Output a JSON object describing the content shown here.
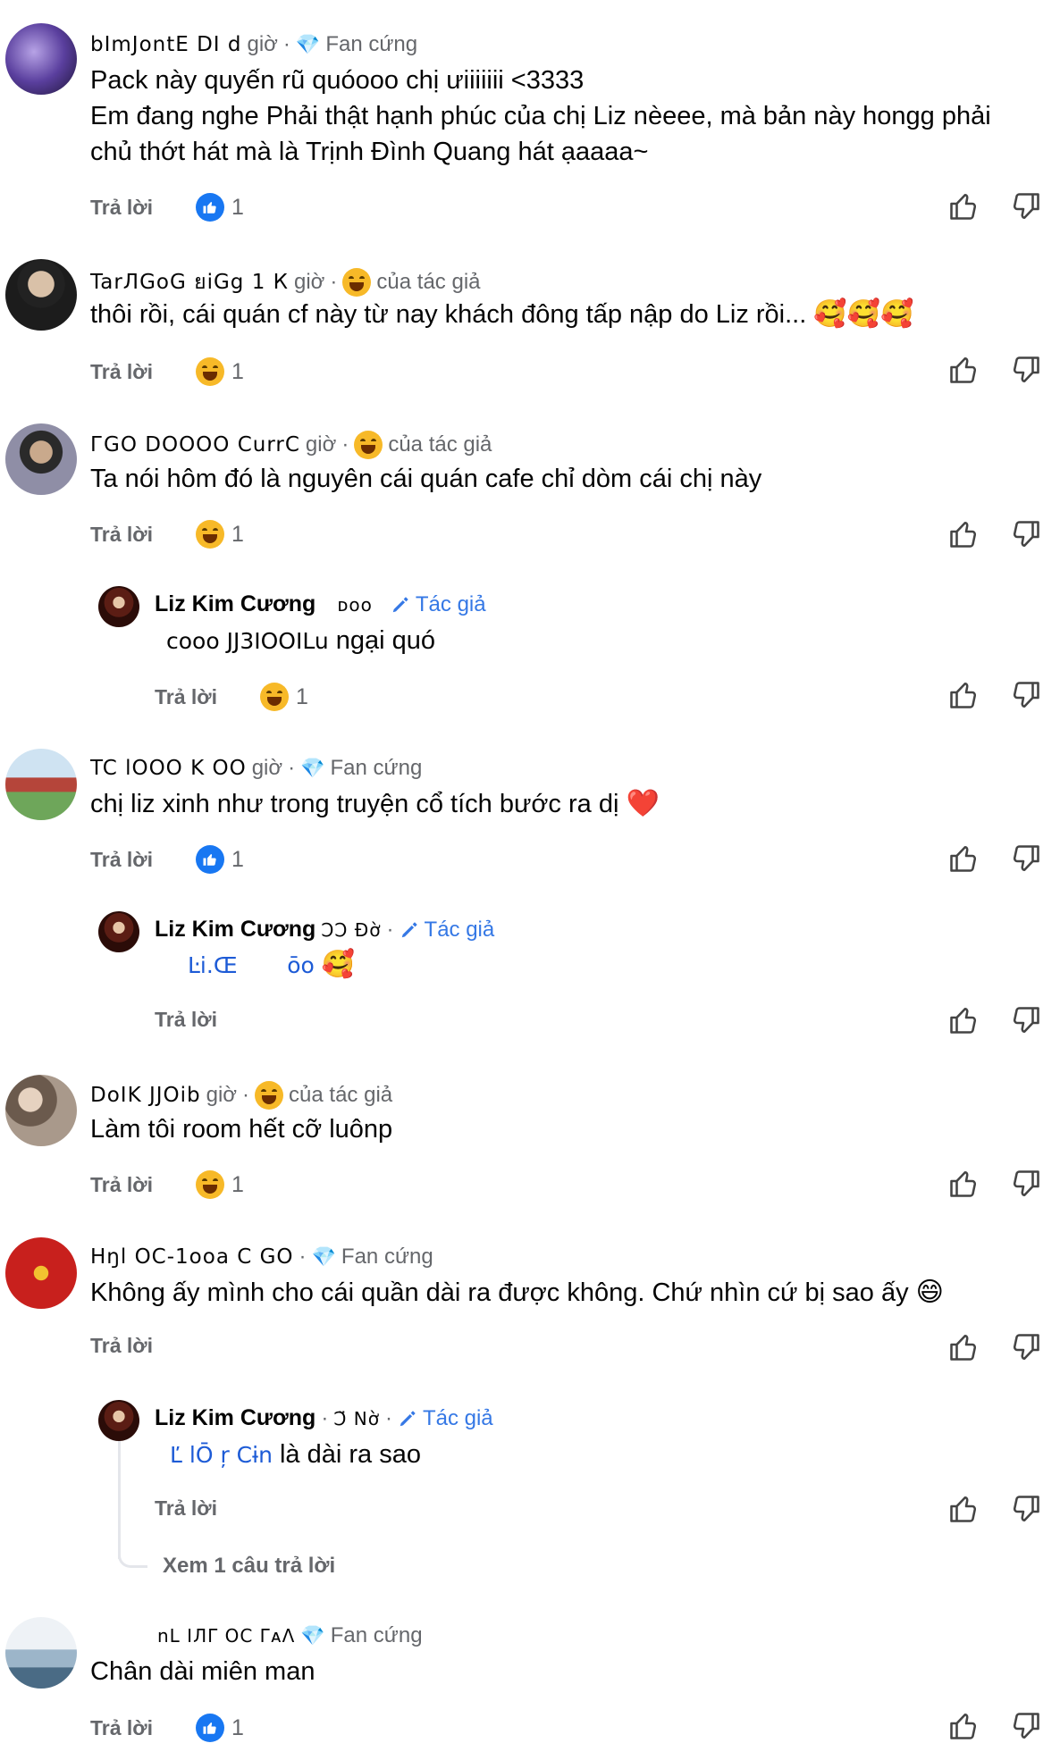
{
  "labels": {
    "reply": "Trả lời",
    "fan": "Fan cứng",
    "author_reacted": "của tác giả",
    "author_tag": "Tác giả",
    "hours_suffix": "giờ",
    "see_replies": "Xem 1 câu trả lời"
  },
  "colors": {
    "blue": "#1877f2",
    "gray": "#65676b",
    "author": "#3578e5"
  },
  "comments": [
    {
      "name": "bImJontE DI d",
      "time": "giờ",
      "badge": "Fan cứng",
      "text1": "Pack này quyến rũ quóooo chị ưiiiiiii <3333",
      "text2": "Em đang nghe Phải thật hạnh phúc của chị Liz nèeee, mà bản này hongg phải",
      "text3": "chủ thớt hát mà là Trịnh Đình Quang hát ạaaaa~",
      "reaction": "like",
      "count": "1"
    },
    {
      "name": "TarЛGoG ยiGg 1 К",
      "time": "giờ",
      "badge": "của tác giả",
      "text1": "thôi rồi, cái quán cf này từ nay khách đông tấp nập do Liz rồi...",
      "emoji": "🥰🥰🥰",
      "reaction": "haha",
      "count": "1"
    },
    {
      "name": "ГGO DOOOO CurrC",
      "time": "giờ",
      "badge": "của tác giả",
      "text1": "Ta nói hôm đó là nguyên cái quán cafe chỉ dòm cái chị này",
      "reaction": "haha",
      "count": "1",
      "reply": {
        "name": "Liz Kim Cương",
        "time": "ᴅᴏᴏ",
        "tag": "Tác giả",
        "link": "cooo JJ3IOOILu",
        "text": "ngại quó",
        "reaction": "haha",
        "count": "1"
      }
    },
    {
      "name": "TC lOOO K OO",
      "time": "giờ",
      "badge": "Fan cứng",
      "text1": "chị liz xinh như trong truyện cổ tích bước ra dị",
      "emoji": "❤️",
      "reaction": "like",
      "count": "1",
      "reply": {
        "name": "Liz Kim Cương",
        "time": "ϽϽ Đờ",
        "tag": "Tác giả",
        "link": "Ŀi.Œ       ōo",
        "text": "",
        "emoji": "🥰"
      }
    },
    {
      "name": "DoIK JJOib",
      "time": "giờ",
      "badge": "của tác giả",
      "text1": "Làm tôi room hết cỡ luônp",
      "reaction": "haha",
      "count": "1"
    },
    {
      "name": "Hŋl OC-1ooa C GO",
      "time": "",
      "badge": "Fan cứng",
      "text1": "Không ấy mình cho cái quần dài ra được không. Chứ nhìn cứ bị sao ấy",
      "emoji": "😄",
      "reply": {
        "name": "Liz Kim Cương",
        "time": "Ͻ̈ Nờ",
        "tag": "Tác giả",
        "link": "Ľ lŌ ŗ Cɨn",
        "text": "là dài ra sao"
      }
    },
    {
      "name": "nL IЛΓ OC ΓᴀΛ",
      "time": "",
      "badge": "Fan cứng",
      "text1": "Chân dài miên man",
      "reaction": "like",
      "count": "1"
    }
  ]
}
